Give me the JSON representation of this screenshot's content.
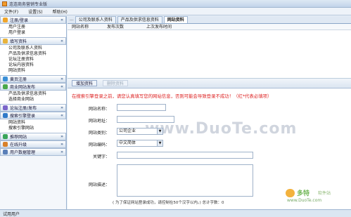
{
  "window": {
    "title": "连连商务营销专业版"
  },
  "menu": [
    "文件(F)",
    "设置(S)",
    "帮助(H)"
  ],
  "sidebar": {
    "sections": [
      {
        "label": "注册/登录",
        "color": "#f0a52a",
        "items": [
          "用户注册",
          "用户登录"
        ]
      },
      {
        "label": "填写资料",
        "color": "#e8b33c",
        "items": [
          "公司及联系人资料",
          "产品及供求信息资料",
          "论坛注册资料",
          "论坛内容资料",
          "网站资料"
        ]
      },
      {
        "label": "黄页注册",
        "color": "#3a8fd6",
        "items": []
      },
      {
        "label": "商业网站发布",
        "color": "#4aa84a",
        "items": [
          "产品及供求信息资料",
          "选择商业网站"
        ]
      },
      {
        "label": "论坛注册/发布",
        "color": "#7b66c9",
        "items": []
      },
      {
        "label": "搜索引擎登录",
        "color": "#2f7ac8",
        "items": [
          "网站资料",
          "搜索引擎网站"
        ]
      },
      {
        "label": "推荐网站",
        "color": "#3aa55a",
        "items": []
      },
      {
        "label": "在线升级",
        "color": "#d8812a",
        "items": []
      },
      {
        "label": "用户数据管理",
        "color": "#5a7fb8",
        "items": []
      }
    ]
  },
  "tabs": {
    "prefix": "...",
    "items": [
      "公司及联系人资料",
      "产品及供求信息资料",
      "网站资料"
    ],
    "active": 2
  },
  "grid": {
    "columns": [
      "网站名称",
      "发布次数",
      "上次发布时间"
    ]
  },
  "actions": {
    "add": "增加资料",
    "delete": "删除资料"
  },
  "form": {
    "notice": "在搜索引擎登录之前，请您认真填写您的网站信息，否则可能会导致登录不成功！（红*代表必填项）",
    "name_label": "网站名称：",
    "url_label": "网站地址：",
    "category_label": "网站类别：",
    "category_value": "公司企业",
    "encoding_label": "网站编码：",
    "encoding_value": "中文简体",
    "keywords_label": "关键字：",
    "desc_label": "网站描述：",
    "hint": "( 为了保证网站登录成功，请控制在50个汉字以内。)    总计字数：0"
  },
  "status": {
    "text": "试用用户"
  },
  "watermarks": {
    "center": "www.DuoTe.com",
    "brand": "多特",
    "brand_sub": "软件站",
    "brand_url": "www.DuoTe.com"
  }
}
